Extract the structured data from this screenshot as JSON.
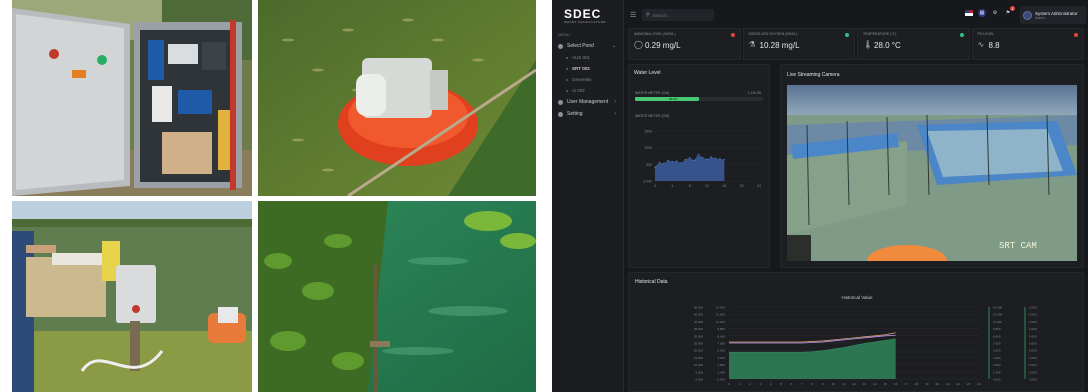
{
  "dashboard": {
    "logo": {
      "main": "SDEC",
      "sub": "SMART AQUACULTURE"
    },
    "menu_caption": "MENU",
    "nav": {
      "select_pond": "Select Pond",
      "ponds": [
        "AUS 001",
        "SRT 003",
        "Generetix",
        "Ai 002"
      ],
      "active_pond_index": 1,
      "user_management": "User Management",
      "setting": "Setting"
    },
    "search": {
      "placeholder": "Search..."
    },
    "user": {
      "name": "System Administrator",
      "role": "Admin"
    },
    "notifications_count": "1",
    "kpis": [
      {
        "label": "AMMONIA LEVEL (NH3/L)",
        "value": "0.29 mg/L",
        "icon": "droplet-outline-icon",
        "status_color": "#e0443e"
      },
      {
        "label": "DISSOLVED OXYGEN (NH3/L)",
        "value": "10.28 mg/L",
        "icon": "flask-icon",
        "status_color": "#2ec27e"
      },
      {
        "label": "TEMPERATURE (°C)",
        "value": "28.0 °C",
        "icon": "thermometer-icon",
        "status_color": "#2ec27e"
      },
      {
        "label": "PH LEVEL",
        "value": "8.8",
        "icon": "pulse-icon",
        "status_color": "#e0443e"
      }
    ],
    "water_level": {
      "title": "Water Level",
      "label": "WATER METER (CM)",
      "value_label": "1,130.56",
      "bar_text": "86.8%",
      "fill_fraction": 0.5,
      "history_label": "WATER METER (CM)"
    },
    "camera": {
      "title": "Live Streaming Camera",
      "overlay": "SRT CAM"
    },
    "history": {
      "title": "Historical Data",
      "chart_title": "Historical Value"
    }
  },
  "chart_data": [
    {
      "type": "area",
      "title": "",
      "y_ticks": [
        "1500",
        "1000",
        "500",
        "0.000"
      ],
      "x_ticks": [
        "0",
        "4",
        "8",
        "12",
        "16",
        "20",
        "24"
      ],
      "x": [
        0,
        1,
        2,
        3,
        4,
        5,
        6,
        7,
        8,
        9,
        10,
        11,
        12,
        13,
        14,
        15,
        16
      ],
      "values": [
        420,
        560,
        520,
        620,
        580,
        600,
        540,
        640,
        700,
        620,
        800,
        700,
        650,
        720,
        680,
        660,
        640
      ],
      "ylim": [
        0,
        1500
      ],
      "xlim": [
        0,
        24
      ],
      "color": "#3b5998"
    },
    {
      "type": "line",
      "title": "Historical Value",
      "x_ticks": [
        "0",
        "1",
        "2",
        "3",
        "4",
        "5",
        "6",
        "7",
        "8",
        "9",
        "10",
        "11",
        "12",
        "13",
        "14",
        "15",
        "16",
        "17",
        "18",
        "19",
        "20",
        "21",
        "22",
        "23",
        "24"
      ],
      "x": [
        0,
        1,
        2,
        3,
        4,
        5,
        6,
        7,
        8,
        9,
        10,
        11,
        12,
        13,
        14,
        15,
        16
      ],
      "left_ticks": [
        "50.000",
        "45.000",
        "40.000",
        "35.000",
        "30.000",
        "25.000",
        "20.000",
        "15.000",
        "10.000",
        "5.000",
        "0.000"
      ],
      "left2_ticks": [
        "14.000",
        "12.600",
        "11.200",
        "9.800",
        "8.400",
        "7.000",
        "5.600",
        "4.200",
        "2.800",
        "1.400",
        "0.000"
      ],
      "right_ticks": [
        "14.000",
        "12.600",
        "11.200",
        "9.800",
        "8.400",
        "7.000",
        "5.600",
        "4.200",
        "2.800",
        "1.400",
        "0.000"
      ],
      "right2_ticks": [
        "0.000",
        "0.000",
        "0.000",
        "0.000",
        "0.000",
        "0.000",
        "0.000",
        "0.000",
        "0.000",
        "0.000",
        "0.000"
      ],
      "series": [
        {
          "color": "#d4a373",
          "values": [
            7.2,
            7.2,
            7.2,
            7.2,
            7.2,
            7.2,
            7.2,
            7.2,
            7.3,
            7.4,
            7.6,
            7.8,
            8.0,
            8.2,
            8.4,
            8.6,
            9.0
          ]
        },
        {
          "color": "#b794f4",
          "values": [
            7.0,
            7.0,
            7.0,
            7.0,
            7.0,
            7.0,
            7.0,
            7.0,
            7.1,
            7.2,
            7.4,
            7.6,
            7.8,
            8.0,
            8.2,
            8.4,
            8.5
          ]
        },
        {
          "color": "#2f855a",
          "fill": true,
          "values": [
            5.2,
            5.2,
            5.2,
            5.2,
            5.2,
            5.2,
            5.2,
            5.2,
            5.3,
            5.5,
            5.8,
            6.1,
            6.5,
            6.9,
            7.2,
            7.5,
            7.8
          ]
        }
      ],
      "ylim": [
        0,
        14
      ],
      "xlim": [
        0,
        24
      ]
    }
  ]
}
